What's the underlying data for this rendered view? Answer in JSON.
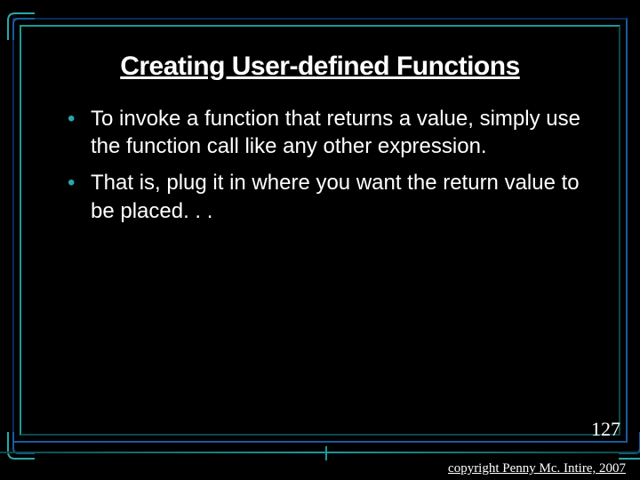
{
  "title": "Creating User-defined Functions",
  "bullets": [
    "To invoke a function that returns a value, simply use the function call like any other expression.",
    "That is, plug it in where you want the return value to be placed. . ."
  ],
  "page_number": "127",
  "copyright": "copyright Penny Mc. Intire, 2007"
}
